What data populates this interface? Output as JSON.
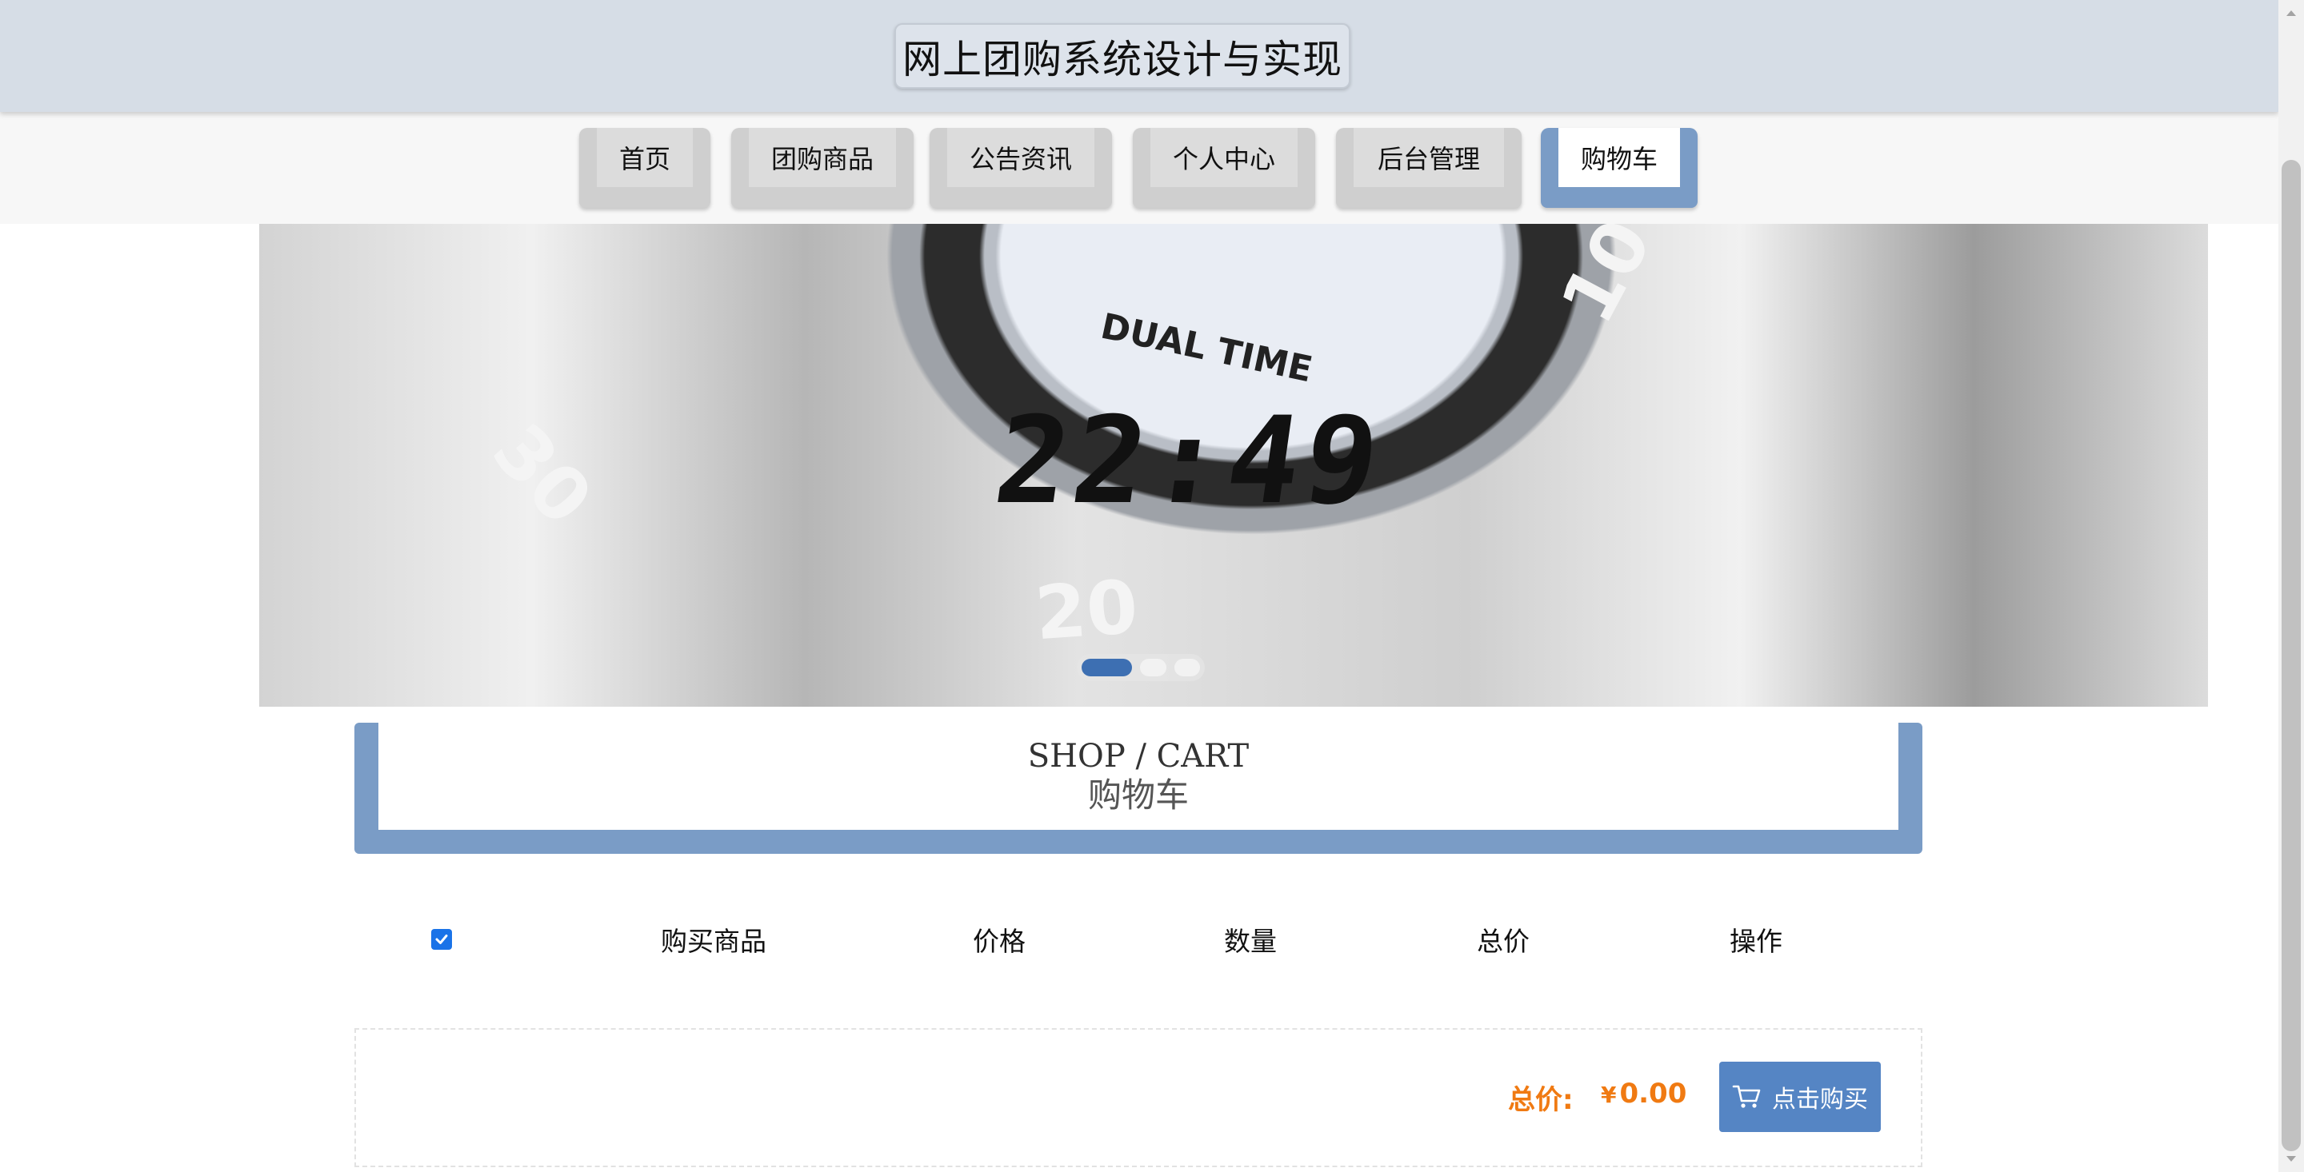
{
  "header": {
    "site_title": "网上团购系统设计与实现"
  },
  "nav": {
    "items": [
      {
        "label": "首页",
        "active": false
      },
      {
        "label": "团购商品",
        "active": false
      },
      {
        "label": "公告资讯",
        "active": false
      },
      {
        "label": "个人中心",
        "active": false
      },
      {
        "label": "后台管理",
        "active": false
      },
      {
        "label": "购物车",
        "active": true
      }
    ]
  },
  "banner": {
    "dial_digits": "22:49",
    "dial_text": "DUAL TIME",
    "bezel_numbers": [
      "30",
      "20",
      "10"
    ],
    "slide_count": 3,
    "active_slide": 1
  },
  "section": {
    "title_en": "SHOP / CART",
    "title_cn": "购物车"
  },
  "table": {
    "select_all_checked": true,
    "columns": [
      "购买商品",
      "价格",
      "数量",
      "总价",
      "操作"
    ]
  },
  "summary": {
    "total_label": "总价:",
    "currency_symbol": "¥",
    "total_value": "0.00",
    "buy_button_label": "点击购买"
  },
  "colors": {
    "accent": "#7a9cc6",
    "button": "#5585c4",
    "total": "#f07a12",
    "header_bg": "#d6dde6"
  }
}
